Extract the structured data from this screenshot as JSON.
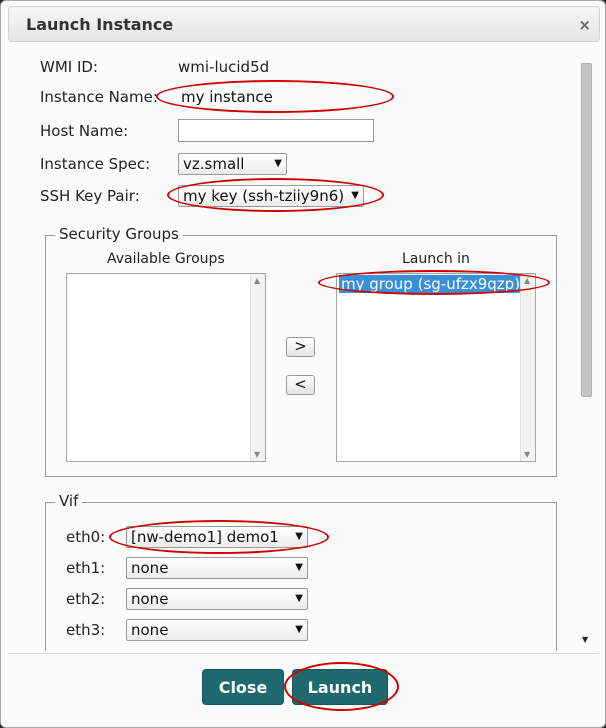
{
  "dialog": {
    "title": "Launch Instance",
    "close_glyph": "×"
  },
  "form": {
    "wmi_id_label": "WMI ID:",
    "wmi_id_value": "wmi-lucid5d",
    "instance_name_label": "Instance Name:",
    "instance_name_value": "my instance",
    "host_name_label": "Host Name:",
    "host_name_value": "",
    "instance_spec_label": "Instance Spec:",
    "instance_spec_value": "vz.small",
    "ssh_key_label": "SSH Key Pair:",
    "ssh_key_value": "my key (ssh-tziiy9n6)"
  },
  "security_groups": {
    "legend": "Security Groups",
    "available_label": "Available Groups",
    "available_items": [],
    "launch_in_label": "Launch in",
    "launch_in_items": [
      "my group (sg-ufzx9qzp)"
    ],
    "add_glyph": ">",
    "remove_glyph": "<"
  },
  "vif": {
    "legend": "Vif",
    "rows": [
      {
        "label": "eth0:",
        "value": "[nw-demo1] demo1"
      },
      {
        "label": "eth1:",
        "value": "none"
      },
      {
        "label": "eth2:",
        "value": "none"
      },
      {
        "label": "eth3:",
        "value": "none"
      }
    ]
  },
  "buttons": {
    "close": "Close",
    "launch": "Launch"
  },
  "icons": {
    "dropdown": "chevron-down-icon",
    "close": "close-icon"
  },
  "colors": {
    "button": "#1e6a6f",
    "highlight": "#d00000",
    "selection": "#3a8fd9"
  }
}
